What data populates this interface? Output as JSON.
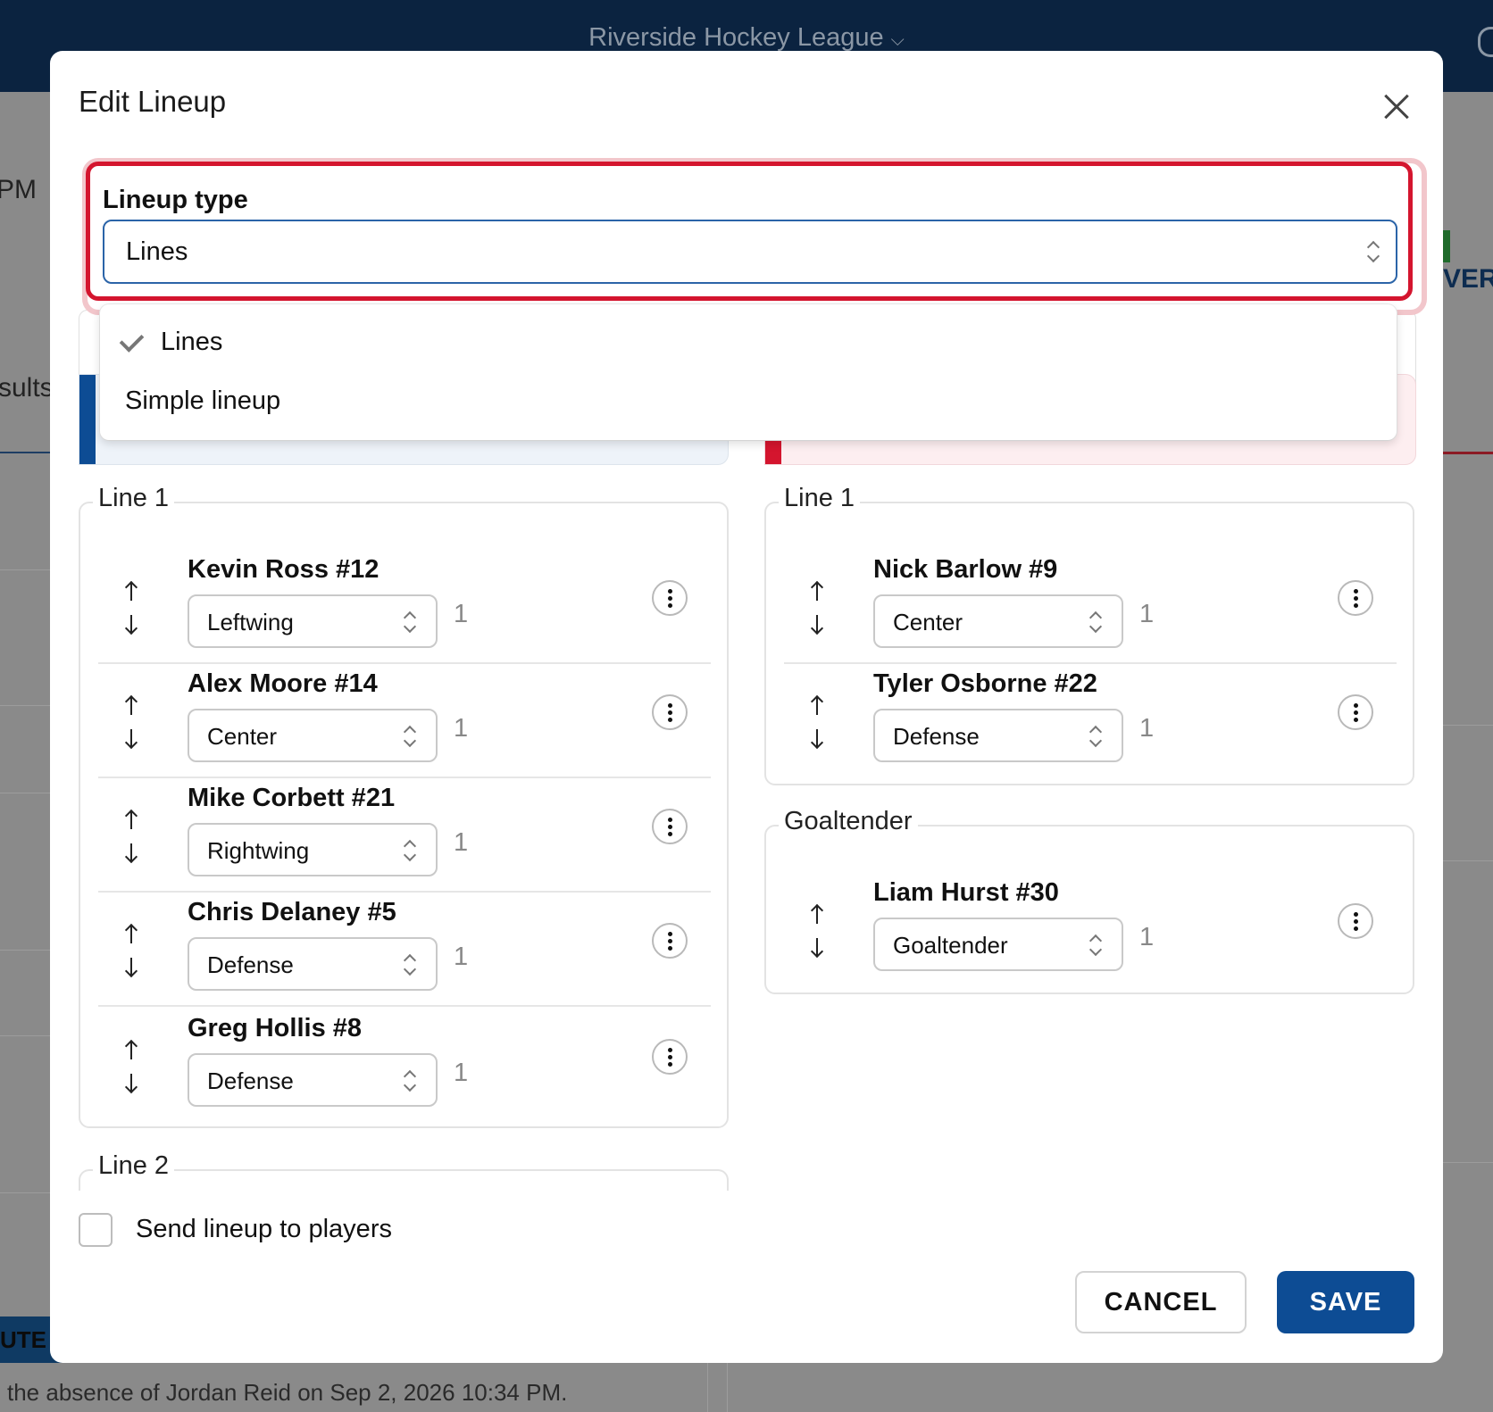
{
  "background": {
    "league_title": "Riverside Hockey League",
    "left_fragment_time": "PM",
    "left_fragment_results": "sults",
    "left_fragment_badge": "UTE S",
    "right_fragment": "VER",
    "footer_note": "the absence of Jordan Reid on Sep 2, 2026 10:34 PM."
  },
  "modal": {
    "title": "Edit Lineup",
    "lineup_type": {
      "label": "Lineup type",
      "selected": "Lines",
      "options": [
        {
          "label": "Lines",
          "checked": true
        },
        {
          "label": "Simple lineup",
          "checked": false
        }
      ]
    },
    "left_team": {
      "groups": [
        {
          "legend": "Line 1",
          "players": [
            {
              "name": "Kevin Ross #12",
              "position": "Leftwing",
              "line": "1"
            },
            {
              "name": "Alex Moore #14",
              "position": "Center",
              "line": "1"
            },
            {
              "name": "Mike Corbett #21",
              "position": "Rightwing",
              "line": "1"
            },
            {
              "name": "Chris Delaney #5",
              "position": "Defense",
              "line": "1"
            },
            {
              "name": "Greg Hollis #8",
              "position": "Defense",
              "line": "1"
            }
          ]
        },
        {
          "legend": "Line 2",
          "players": []
        }
      ]
    },
    "right_team": {
      "groups": [
        {
          "legend": "Line 1",
          "players": [
            {
              "name": "Nick Barlow #9",
              "position": "Center",
              "line": "1"
            },
            {
              "name": "Tyler Osborne #22",
              "position": "Defense",
              "line": "1"
            }
          ]
        },
        {
          "legend": "Goaltender",
          "players": [
            {
              "name": "Liam Hurst #30",
              "position": "Goaltender",
              "line": "1"
            }
          ]
        }
      ]
    },
    "send_lineup_label": "Send lineup to players",
    "send_lineup_checked": false,
    "cancel_label": "CANCEL",
    "save_label": "SAVE"
  },
  "colors": {
    "header_bg": "#0b2340",
    "focus_red": "#d4152e",
    "primary_blue": "#0d4c94",
    "home_stripe": "#0d4c94",
    "away_stripe": "#d4152e"
  }
}
